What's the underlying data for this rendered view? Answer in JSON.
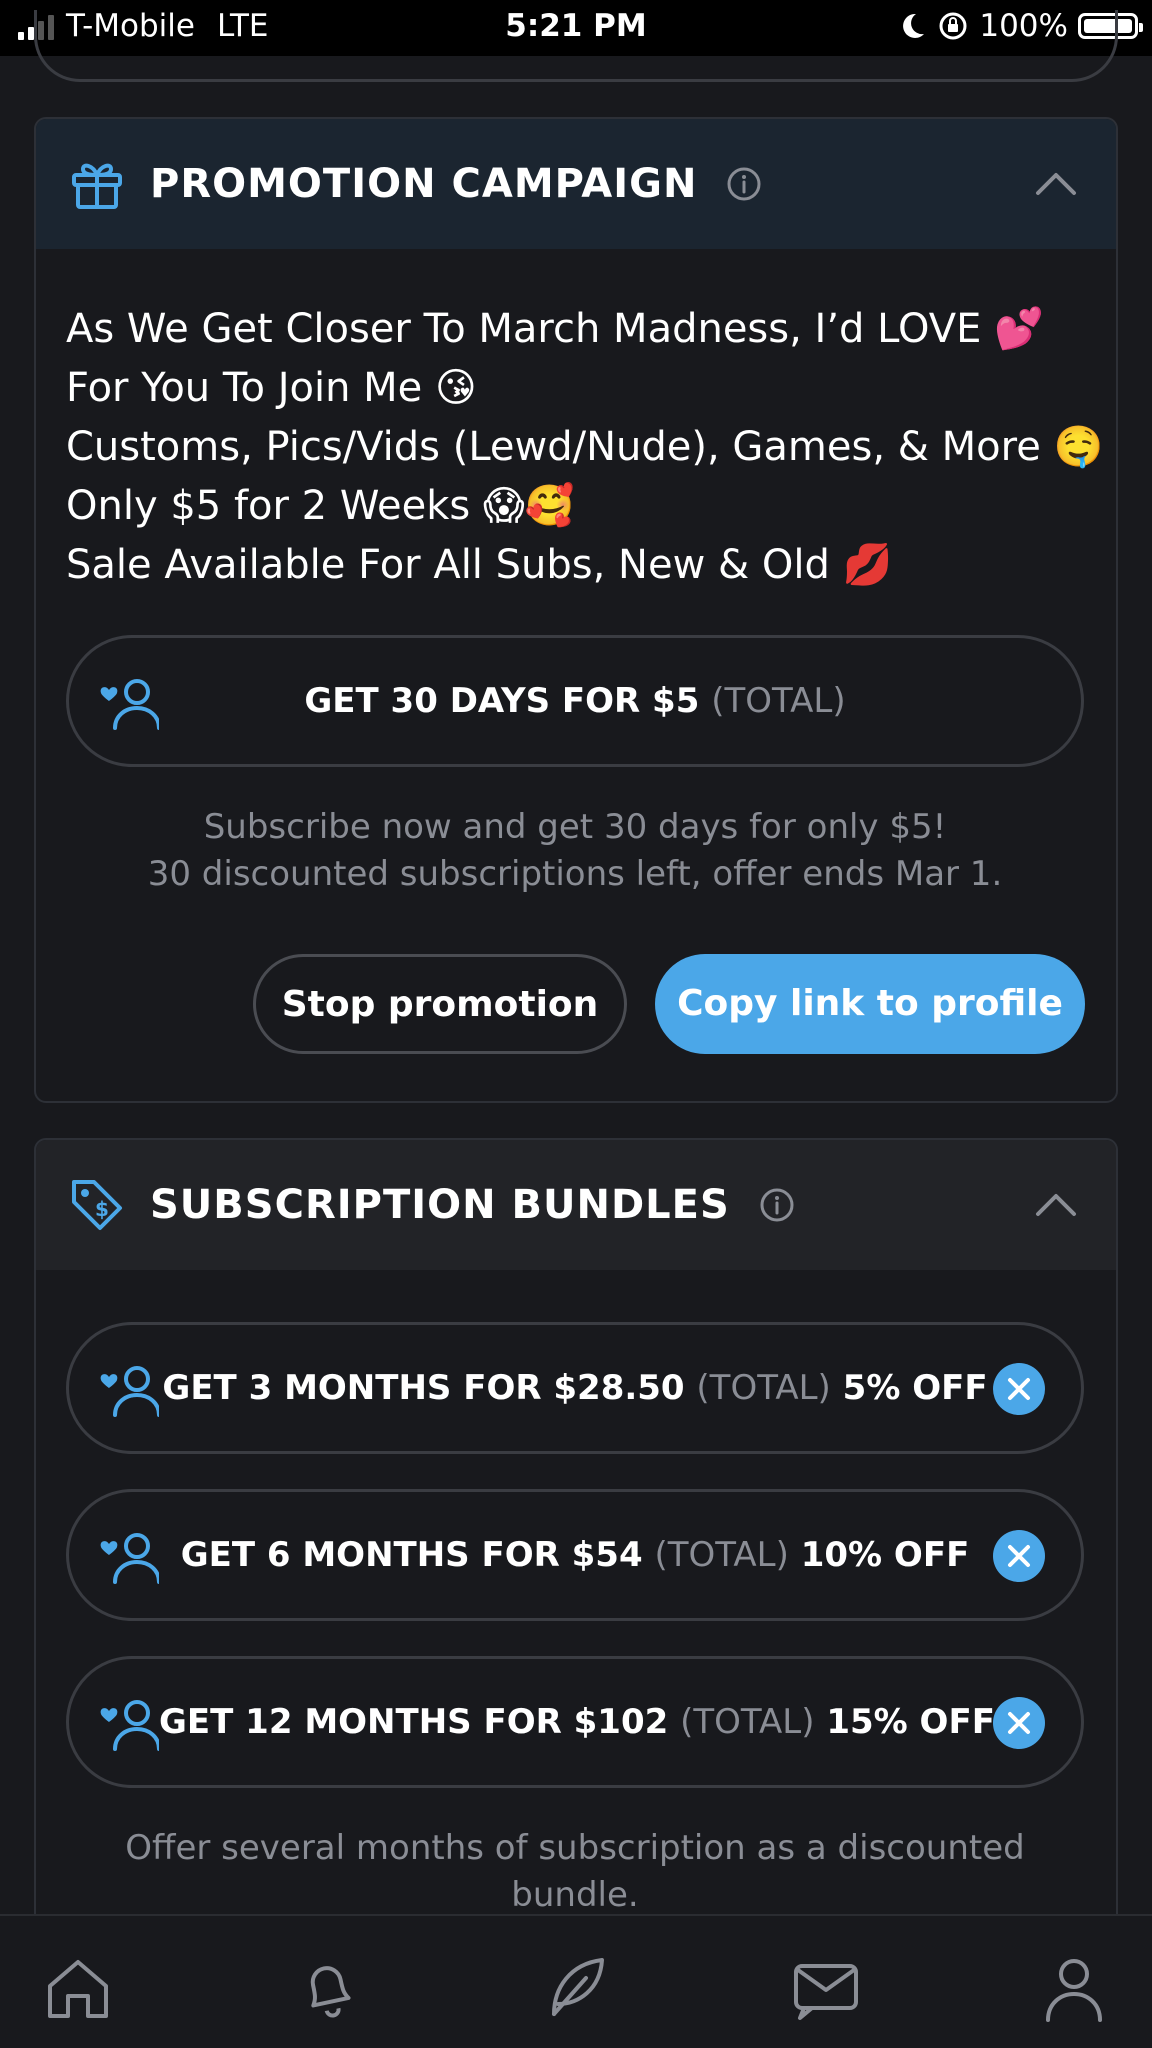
{
  "status_bar": {
    "carrier": "T-Mobile",
    "network": "LTE",
    "time": "5:21 PM",
    "battery": "100%"
  },
  "promotion": {
    "title": "PROMOTION CAMPAIGN",
    "message_lines": [
      "As We Get Closer To March Madness, I’d LOVE 💕",
      "For You To Join Me 😘",
      "Customs, Pics/Vids (Lewd/Nude), Games, & More 🤤",
      "Only $5 for 2 Weeks 😱🥰",
      "Sale Available For All Subs, New & Old 💋"
    ],
    "offer": {
      "main": "GET 30 DAYS FOR $5",
      "suffix": "(TOTAL)"
    },
    "note_lines": [
      "Subscribe now and get 30 days for only $5!",
      "30 discounted subscriptions left, offer ends Mar 1."
    ],
    "stop_label": "Stop promotion",
    "copy_label": "Copy link to profile"
  },
  "bundles": {
    "title": "SUBSCRIPTION BUNDLES",
    "items": [
      {
        "main": "GET 3 MONTHS FOR $28.50",
        "suffix": "(TOTAL)",
        "discount": "5% OFF"
      },
      {
        "main": "GET 6 MONTHS FOR $54",
        "suffix": "(TOTAL)",
        "discount": "10% OFF"
      },
      {
        "main": "GET 12 MONTHS FOR $102",
        "suffix": "(TOTAL)",
        "discount": "15% OFF"
      }
    ],
    "note_lines": [
      "Offer several months of subscription as a discounted",
      "bundle."
    ]
  },
  "colors": {
    "accent": "#4ba7e8",
    "header_promo_bg": "#1b2530",
    "header_bundles_bg": "#222327",
    "background": "#18191d",
    "muted_text": "#8a8d95"
  },
  "icons": {
    "promotion_header": "gift-icon",
    "bundles_header": "price-tag-icon",
    "info": "info-icon",
    "collapse": "chevron-up-icon",
    "subscriber": "user-heart-icon",
    "remove": "close-icon",
    "nav": [
      "home-icon",
      "bell-icon",
      "feather-icon",
      "message-icon",
      "profile-icon"
    ]
  }
}
